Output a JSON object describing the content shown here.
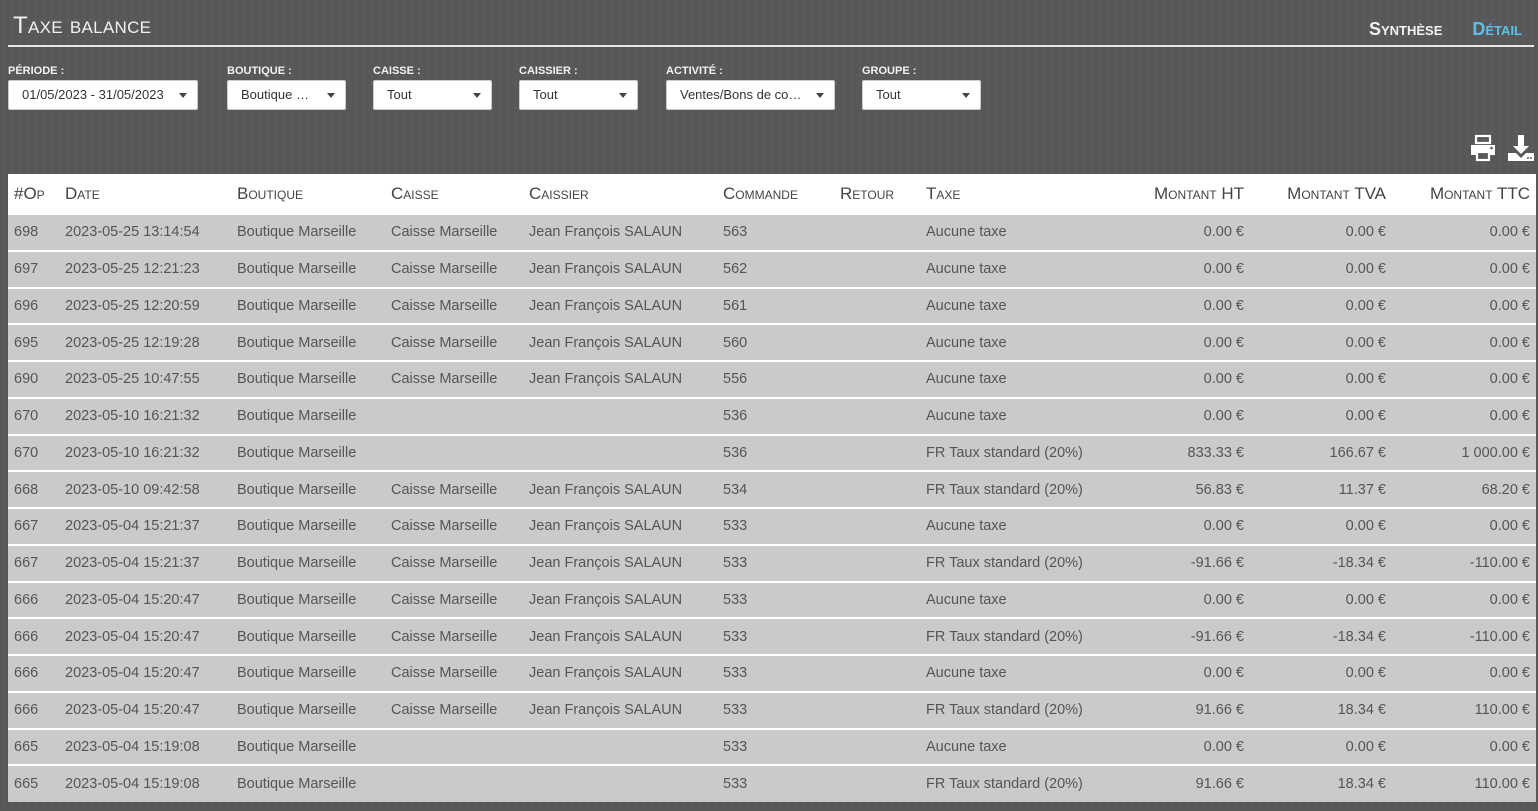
{
  "header": {
    "title": "Taxe balance",
    "nav": [
      {
        "label": "Synthèse",
        "active": false
      },
      {
        "label": "Détail",
        "active": true
      }
    ]
  },
  "filters": {
    "periode": {
      "label": "Période :",
      "value": "01/05/2023 - 31/05/2023"
    },
    "boutique": {
      "label": "Boutique :",
      "value": "Boutique Marseille"
    },
    "caisse": {
      "label": "Caisse :",
      "value": "Tout"
    },
    "caissier": {
      "label": "Caissier :",
      "value": "Tout"
    },
    "activite": {
      "label": "Activité :",
      "value": "Ventes/Bons de commande"
    },
    "groupe": {
      "label": "Groupe :",
      "value": "Tout"
    }
  },
  "toolbar": {
    "print_icon": "print-icon",
    "download_icon": "download-icon"
  },
  "table": {
    "columns": [
      "#Op",
      "Date",
      "Boutique",
      "Caisse",
      "Caissier",
      "Commande",
      "Retour",
      "Taxe",
      "Montant HT",
      "Montant TVA",
      "Montant TTC"
    ],
    "rows": [
      [
        "698",
        "2023-05-25 13:14:54",
        "Boutique Marseille",
        "Caisse Marseille",
        "Jean François SALAUN",
        "563",
        "",
        "Aucune taxe",
        "0.00 €",
        "0.00 €",
        "0.00 €"
      ],
      [
        "697",
        "2023-05-25 12:21:23",
        "Boutique Marseille",
        "Caisse Marseille",
        "Jean François SALAUN",
        "562",
        "",
        "Aucune taxe",
        "0.00 €",
        "0.00 €",
        "0.00 €"
      ],
      [
        "696",
        "2023-05-25 12:20:59",
        "Boutique Marseille",
        "Caisse Marseille",
        "Jean François SALAUN",
        "561",
        "",
        "Aucune taxe",
        "0.00 €",
        "0.00 €",
        "0.00 €"
      ],
      [
        "695",
        "2023-05-25 12:19:28",
        "Boutique Marseille",
        "Caisse Marseille",
        "Jean François SALAUN",
        "560",
        "",
        "Aucune taxe",
        "0.00 €",
        "0.00 €",
        "0.00 €"
      ],
      [
        "690",
        "2023-05-25 10:47:55",
        "Boutique Marseille",
        "Caisse Marseille",
        "Jean François SALAUN",
        "556",
        "",
        "Aucune taxe",
        "0.00 €",
        "0.00 €",
        "0.00 €"
      ],
      [
        "670",
        "2023-05-10 16:21:32",
        "Boutique Marseille",
        "",
        "",
        "536",
        "",
        "Aucune taxe",
        "0.00 €",
        "0.00 €",
        "0.00 €"
      ],
      [
        "670",
        "2023-05-10 16:21:32",
        "Boutique Marseille",
        "",
        "",
        "536",
        "",
        "FR Taux standard (20%)",
        "833.33 €",
        "166.67 €",
        "1 000.00 €"
      ],
      [
        "668",
        "2023-05-10 09:42:58",
        "Boutique Marseille",
        "Caisse Marseille",
        "Jean François SALAUN",
        "534",
        "",
        "FR Taux standard (20%)",
        "56.83 €",
        "11.37 €",
        "68.20 €"
      ],
      [
        "667",
        "2023-05-04 15:21:37",
        "Boutique Marseille",
        "Caisse Marseille",
        "Jean François SALAUN",
        "533",
        "",
        "Aucune taxe",
        "0.00 €",
        "0.00 €",
        "0.00 €"
      ],
      [
        "667",
        "2023-05-04 15:21:37",
        "Boutique Marseille",
        "Caisse Marseille",
        "Jean François SALAUN",
        "533",
        "",
        "FR Taux standard (20%)",
        "-91.66 €",
        "-18.34 €",
        "-110.00 €"
      ],
      [
        "666",
        "2023-05-04 15:20:47",
        "Boutique Marseille",
        "Caisse Marseille",
        "Jean François SALAUN",
        "533",
        "",
        "Aucune taxe",
        "0.00 €",
        "0.00 €",
        "0.00 €"
      ],
      [
        "666",
        "2023-05-04 15:20:47",
        "Boutique Marseille",
        "Caisse Marseille",
        "Jean François SALAUN",
        "533",
        "",
        "FR Taux standard (20%)",
        "-91.66 €",
        "-18.34 €",
        "-110.00 €"
      ],
      [
        "666",
        "2023-05-04 15:20:47",
        "Boutique Marseille",
        "Caisse Marseille",
        "Jean François SALAUN",
        "533",
        "",
        "Aucune taxe",
        "0.00 €",
        "0.00 €",
        "0.00 €"
      ],
      [
        "666",
        "2023-05-04 15:20:47",
        "Boutique Marseille",
        "Caisse Marseille",
        "Jean François SALAUN",
        "533",
        "",
        "FR Taux standard (20%)",
        "91.66 €",
        "18.34 €",
        "110.00 €"
      ],
      [
        "665",
        "2023-05-04 15:19:08",
        "Boutique Marseille",
        "",
        "",
        "533",
        "",
        "Aucune taxe",
        "0.00 €",
        "0.00 €",
        "0.00 €"
      ],
      [
        "665",
        "2023-05-04 15:19:08",
        "Boutique Marseille",
        "",
        "",
        "533",
        "",
        "FR Taux standard (20%)",
        "91.66 €",
        "18.34 €",
        "110.00 €"
      ]
    ]
  },
  "colors": {
    "accent": "#5bc0e8",
    "background": "#58585a",
    "row": "#cacaca"
  }
}
